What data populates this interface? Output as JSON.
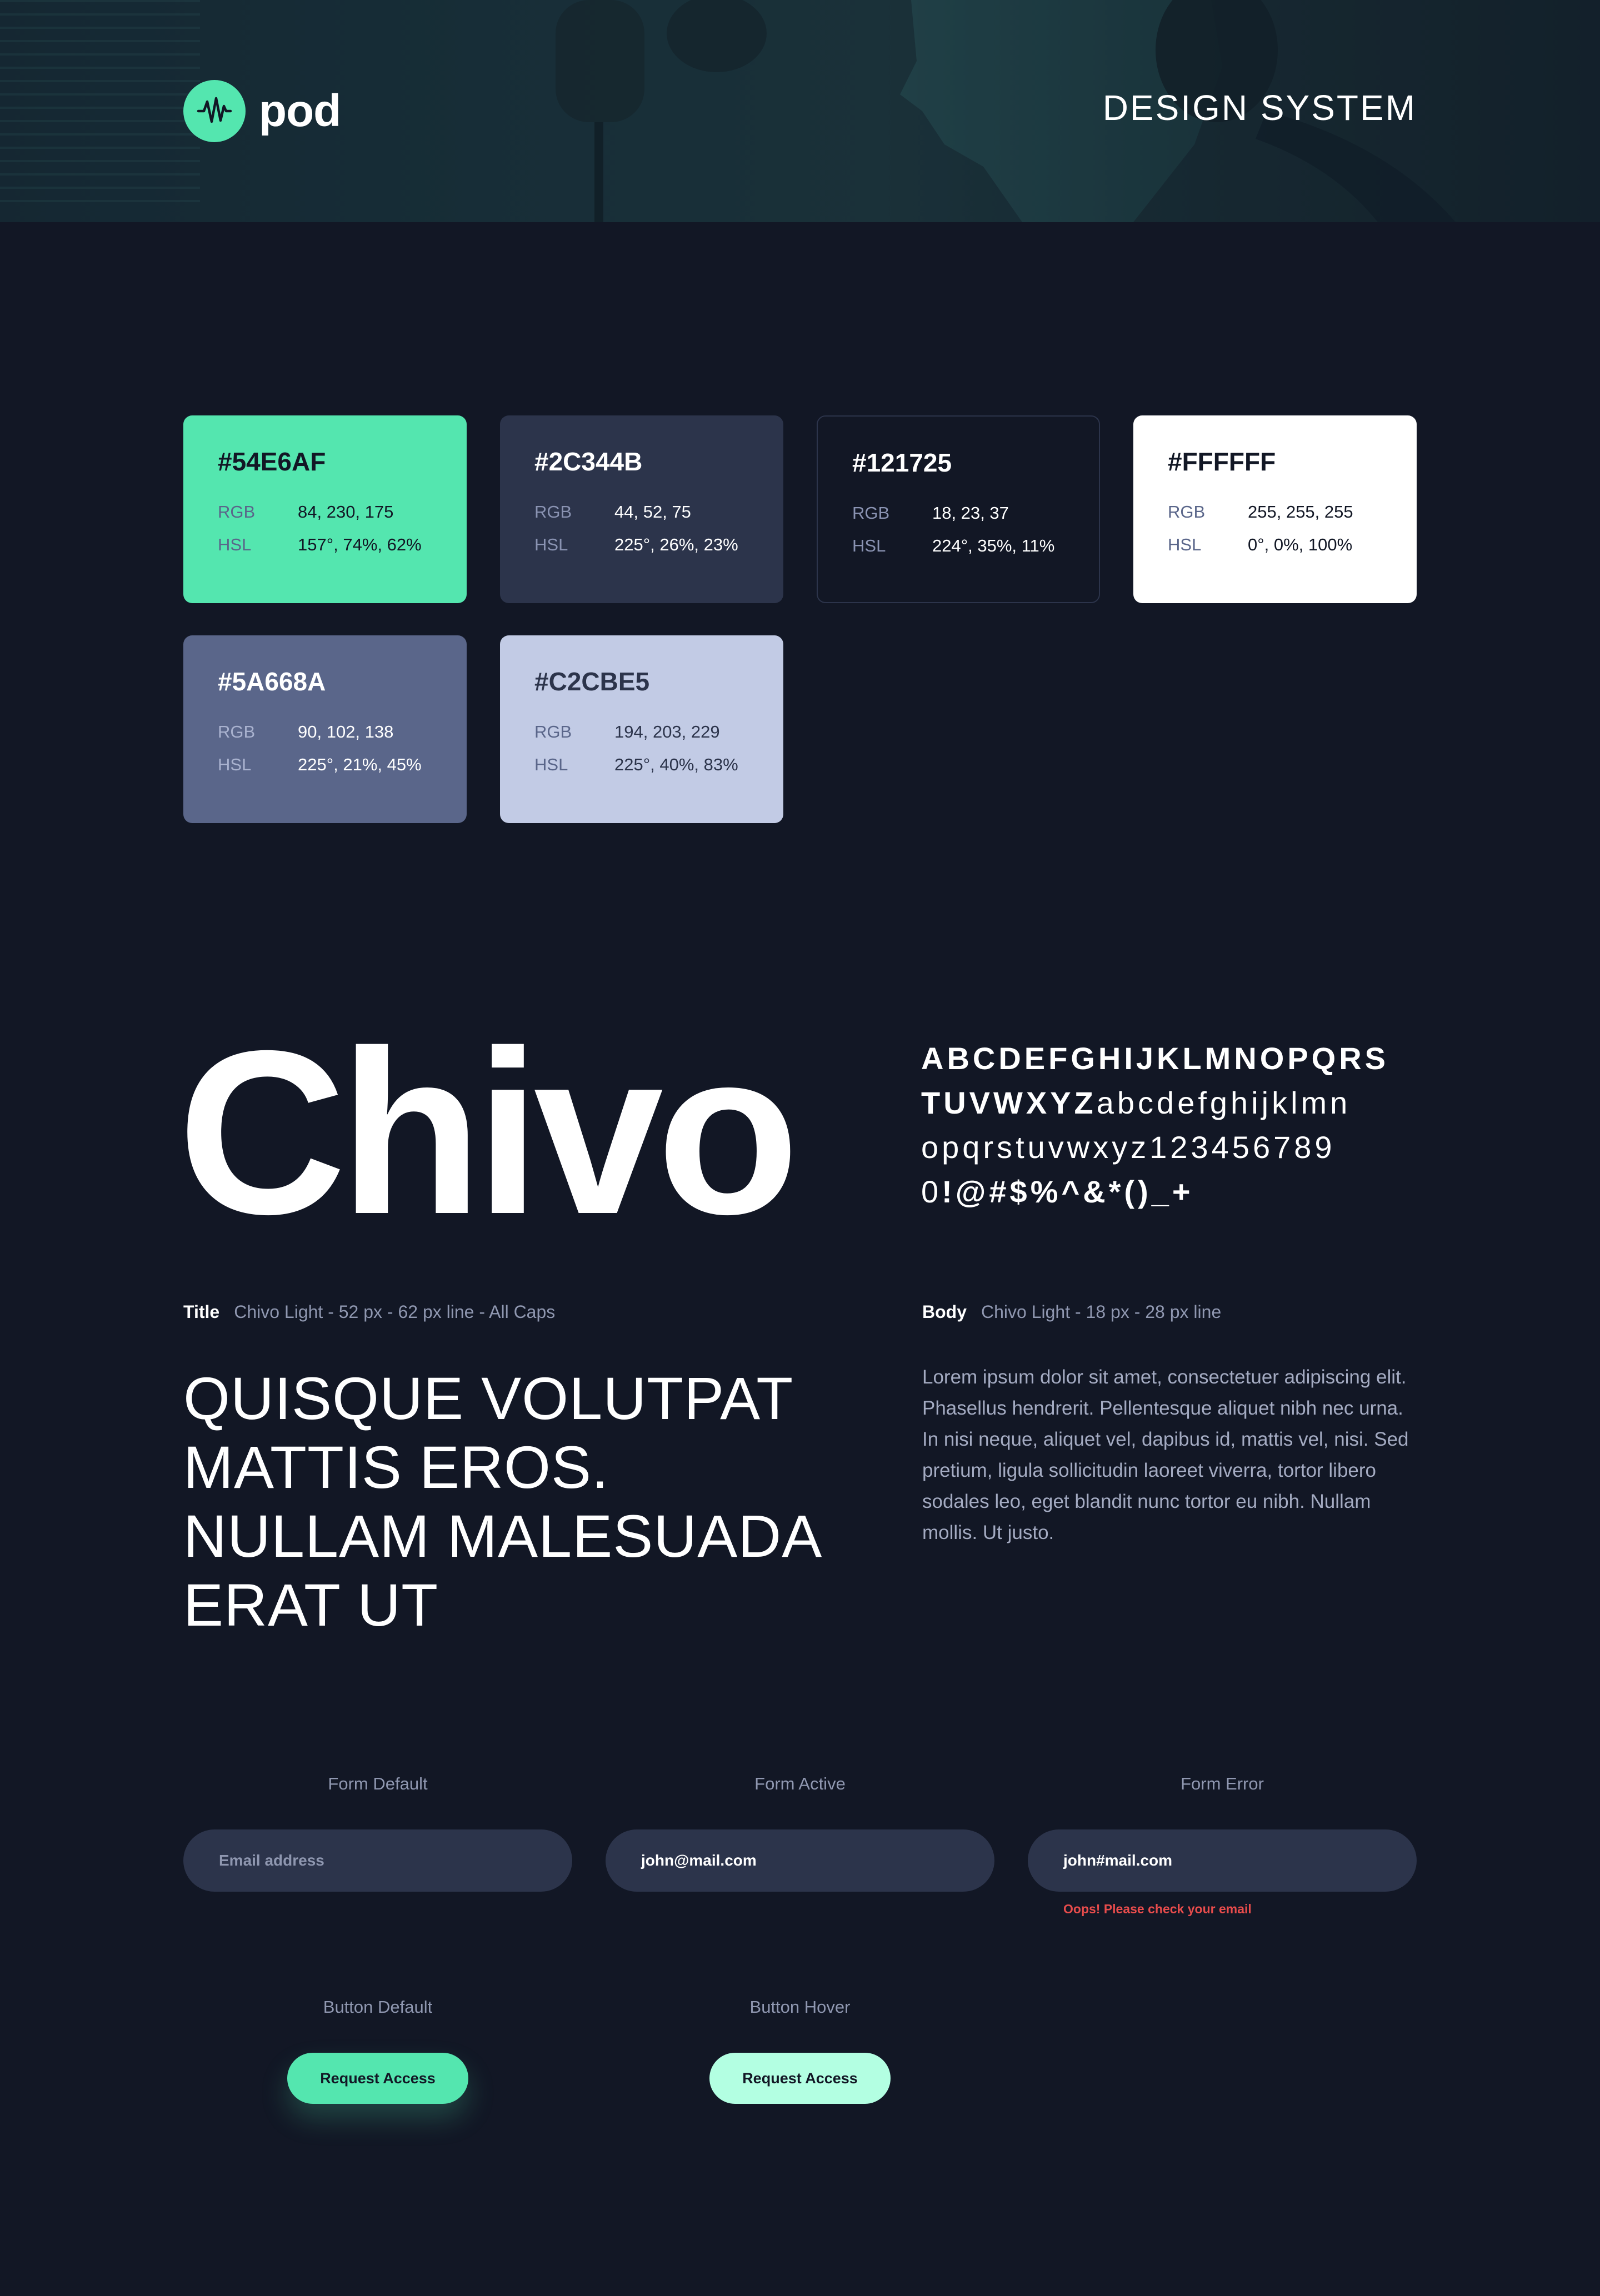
{
  "header": {
    "logo_text": "pod",
    "title": "DESIGN SYSTEM",
    "icons": [
      "waveform-icon"
    ]
  },
  "colors": [
    {
      "hex": "#54E6AF",
      "rgb_label": "RGB",
      "rgb": "84, 230, 175",
      "hsl_label": "HSL",
      "hsl": "157°, 74%, 62%"
    },
    {
      "hex": "#2C344B",
      "rgb_label": "RGB",
      "rgb": "44, 52, 75",
      "hsl_label": "HSL",
      "hsl": "225°, 26%, 23%"
    },
    {
      "hex": "#121725",
      "rgb_label": "RGB",
      "rgb": "18, 23, 37",
      "hsl_label": "HSL",
      "hsl": "224°, 35%, 11%"
    },
    {
      "hex": "#FFFFFF",
      "rgb_label": "RGB",
      "rgb": "255, 255, 255",
      "hsl_label": "HSL",
      "hsl": "0°, 0%, 100%"
    },
    {
      "hex": "#5A668A",
      "rgb_label": "RGB",
      "rgb": "90, 102, 138",
      "hsl_label": "HSL",
      "hsl": "225°, 21%, 45%"
    },
    {
      "hex": "#C2CBE5",
      "rgb_label": "RGB",
      "rgb": "194, 203, 229",
      "hsl_label": "HSL",
      "hsl": "225°, 40%, 83%"
    }
  ],
  "typography": {
    "font_name": "Chivo",
    "charset": {
      "line1": "ABCDEFGHIJKLMNOPQRS",
      "line2_bold": "TUVWXYZ",
      "line2_light": "abcdefghijklmn",
      "line3": "opqrstuvwxyz123456789",
      "line4_light": "0",
      "line4_bold": "!@#$%^&*()_+"
    },
    "title_spec": {
      "label": "Title",
      "desc": "Chivo Light - 52 px - 62 px line - All Caps"
    },
    "body_spec": {
      "label": "Body",
      "desc": "Chivo Light - 18 px - 28 px line"
    },
    "title_sample": "QUISQUE VOLUTPAT MATTIS EROS. NULLAM MALESUADA ERAT UT",
    "body_sample": "Lorem ipsum dolor sit amet, consectetuer adipiscing elit. Phasellus hendrerit. Pellentesque aliquet nibh nec urna. In nisi neque, aliquet vel, dapibus id, mattis vel, nisi. Sed pretium, ligula sollicitudin laoreet viverra, tortor libero sodales leo, eget blandit nunc tortor eu nibh. Nullam mollis. Ut justo."
  },
  "forms": {
    "default": {
      "label": "Form Default",
      "placeholder": "Email address"
    },
    "active": {
      "label": "Form Active",
      "value": "john@mail.com"
    },
    "error": {
      "label": "Form Error",
      "value": "john#mail.com",
      "message": "Oops! Please check your email"
    }
  },
  "buttons": {
    "default": {
      "label": "Button Default",
      "text": "Request Access"
    },
    "hover": {
      "label": "Button Hover",
      "text": "Request Access"
    }
  }
}
